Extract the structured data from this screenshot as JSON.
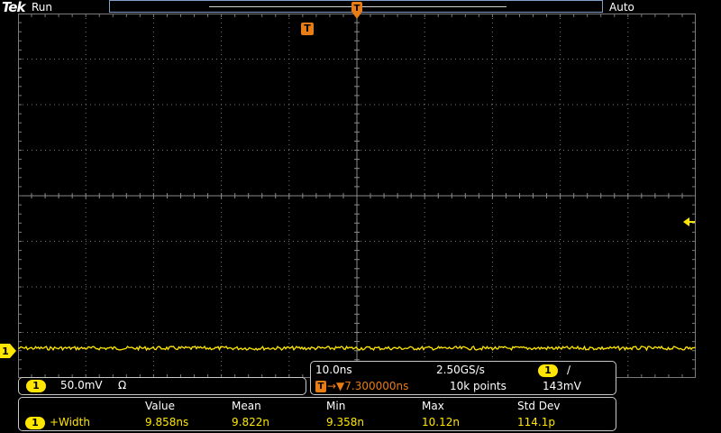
{
  "header": {
    "logo": "Tek",
    "run_state": "Run",
    "trigger_mode": "Auto"
  },
  "markers": {
    "channel": "1",
    "trigger": "T",
    "trigger_level_glyph": "◂"
  },
  "channel_panel": {
    "channel": "1",
    "scale": "50.0mV",
    "termination": "Ω"
  },
  "horizontal_panel": {
    "time_per_div": "10.0ns",
    "sample_rate": "2.50GS/s",
    "trigger_channel": "1",
    "trigger_slope": "∕",
    "trigger_delay": "→▼7.300000ns",
    "record_length": "10k points",
    "trigger_level": "143mV"
  },
  "measurements": {
    "headers": {
      "value": "Value",
      "mean": "Mean",
      "min": "Min",
      "max": "Max",
      "std_dev": "Std Dev"
    },
    "row": {
      "channel": "1",
      "name": "+Width",
      "value": "9.858ns",
      "mean": "9.822n",
      "min": "9.358n",
      "max": "10.12n",
      "std_dev": "114.1p"
    }
  },
  "colors": {
    "ch1": "#ffe600",
    "trigger": "#e87d14",
    "graticule": "#7a7a7a",
    "panel_border": "#c8c8c8"
  }
}
